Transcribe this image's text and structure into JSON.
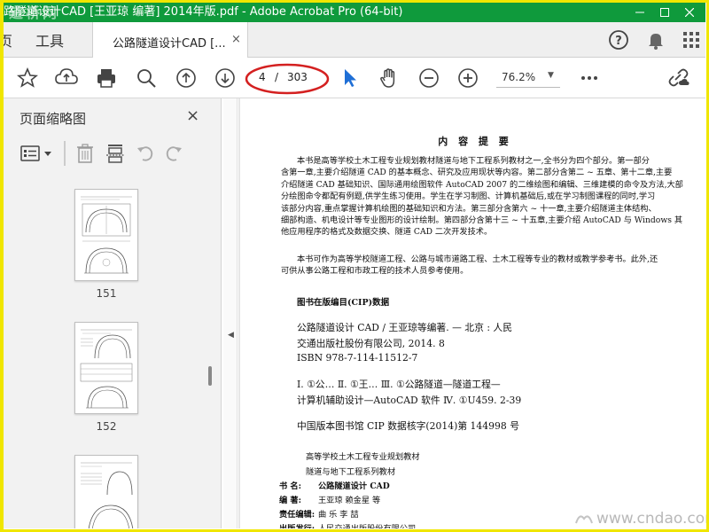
{
  "window": {
    "title": "路隧道设计CAD [王亚琼 编著] 2014年版.pdf - Adobe Acrobat Pro (64-bit)",
    "watermark": "道桥网",
    "minimize_icon": "minimize-icon",
    "maximize_icon": "maximize-icon",
    "close_icon": "close-icon"
  },
  "tabs": {
    "home_partial": "页",
    "tools": "工具",
    "document": "公路隧道设计CAD [...",
    "document_close": "×"
  },
  "toolbar": {
    "page_current": "4",
    "page_separator": "/",
    "page_total": "303",
    "zoom": "76.2%"
  },
  "left_panel": {
    "title": "页面缩略图",
    "close": "×",
    "thumbnails": [
      {
        "number": "151"
      },
      {
        "number": "152"
      },
      {
        "number": ""
      }
    ]
  },
  "document": {
    "heading": "内 容 提 要",
    "para1": [
      "本书是高等学校土木工程专业规划教材隧道与地下工程系列教材之一,全书分为四个部分。第一部分",
      "含第一章,主要介绍隧道 CAD 的基本概念、研究及应用现状等内容。第二部分含第二 ~ 五章、第十二章,主要",
      "介绍隧道 CAD 基础知识、国际通用绘图软件 AutoCAD 2007 的二维绘图和编辑、三维建模的命令及方法,大部",
      "分绘图命令都配有例题,供学生练习使用。学生在学习制图、计算机基础后,或在学习制图课程的同时,学习",
      "该部分内容,重点掌握计算机绘图的基础知识和方法。第三部分含第六 ~ 十一章,主要介绍隧道主体结构、",
      "细部构造、机电设计等专业图形的设计绘制。第四部分含第十三 ~ 十五章,主要介绍 AutoCAD 与 Windows 其",
      "他应用程序的格式及数据交换、隧道 CAD 二次开发技术。"
    ],
    "para2": [
      "本书可作为高等学校隧道工程、公路与城市道路工程、土木工程等专业的教材或教学参考书。此外,还",
      "可供从事公路工程和市政工程的技术人员参考使用。"
    ],
    "cip_heading": "图书在版编目(CIP)数据",
    "cip_lines": [
      "公路隧道设计 CAD / 王亚琼等编著. — 北京 : 人民",
      "交通出版社股份有限公司, 2014. 8",
      "ISBN  978-7-114-11512-7"
    ],
    "class_lines": [
      "Ⅰ. ①公…   Ⅱ. ①王…   Ⅲ. ①公路隧道—隧道工程—",
      "计算机辅助设计—AutoCAD 软件   Ⅳ. ①U459. 2-39"
    ],
    "cip_number": "中国版本图书馆 CIP 数据核字(2014)第 144998 号",
    "series_lines": [
      "高等学校土木工程专业规划教材",
      "隧道与地下工程系列教材"
    ],
    "pub_rows": [
      {
        "label": "书      名:",
        "value": "公路隧道设计 CAD",
        "bold_value": true
      },
      {
        "label": "编      著:",
        "value": "王亚琼    赖金星    等",
        "bold_value": false
      },
      {
        "label": "责任编辑:",
        "value": "曲    乐    李    喆",
        "bold_value": false
      },
      {
        "label": "出版发行:",
        "value": "人民交通出版股份有限公司",
        "bold_value": false
      }
    ]
  },
  "watermark_br": "www.cndao.com",
  "colors": {
    "titlebar": "#0f9a3c",
    "outer_frame": "#f0e600",
    "annotation_oval": "#d42020",
    "select_cursor": "#1f6fd6"
  }
}
